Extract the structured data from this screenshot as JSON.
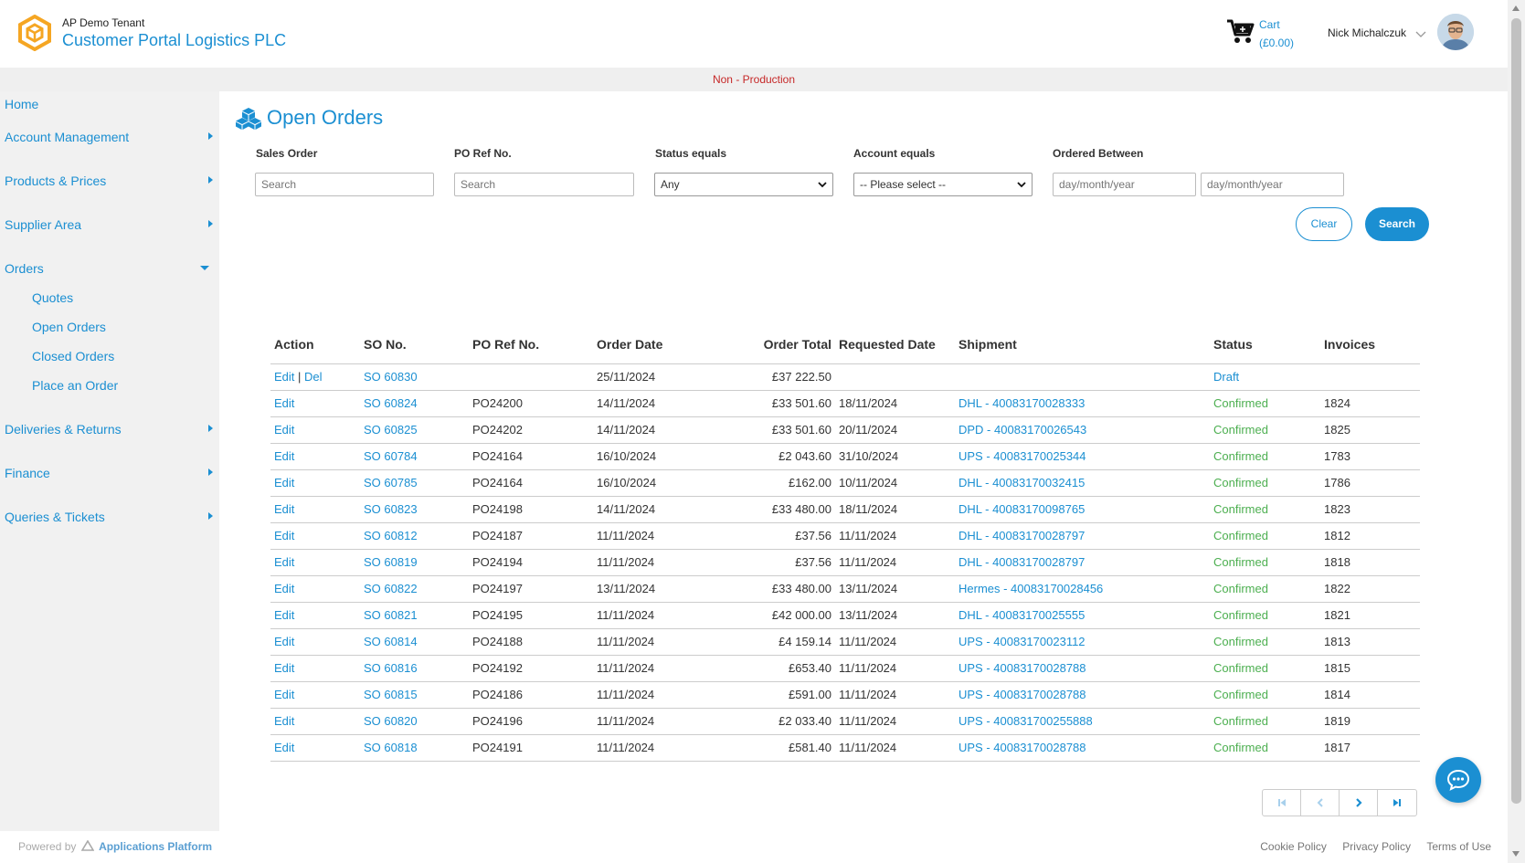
{
  "header": {
    "tenant": "AP Demo Tenant",
    "portal_title": "Customer Portal Logistics PLC",
    "cart_label": "Cart",
    "cart_total": "(£0.00)",
    "user_name": "Nick Michalczuk"
  },
  "environment": "Non - Production",
  "sidebar": {
    "items": [
      {
        "label": "Home"
      },
      {
        "label": "Account Management"
      },
      {
        "label": "Products & Prices"
      },
      {
        "label": "Supplier Area"
      },
      {
        "label": "Orders"
      },
      {
        "label": "Deliveries & Returns"
      },
      {
        "label": "Finance"
      },
      {
        "label": "Queries & Tickets"
      }
    ],
    "orders_sub": [
      {
        "label": "Quotes"
      },
      {
        "label": "Open Orders"
      },
      {
        "label": "Closed Orders"
      },
      {
        "label": "Place an Order"
      }
    ]
  },
  "page": {
    "title": "Open Orders"
  },
  "filters": {
    "sales_order_label": "Sales Order",
    "sales_order_placeholder": "Search",
    "po_ref_label": "PO Ref No.",
    "po_ref_placeholder": "Search",
    "status_label": "Status equals",
    "status_value": "Any",
    "account_label": "Account equals",
    "account_value": "-- Please select --",
    "ordered_between_label": "Ordered Between",
    "date_from_placeholder": "day/month/year",
    "date_to_placeholder": "day/month/year",
    "clear_label": "Clear",
    "search_label": "Search"
  },
  "table": {
    "headers": [
      "Action",
      "SO No.",
      "PO Ref No.",
      "Order Date",
      "Order Total",
      "Requested Date",
      "Shipment",
      "Status",
      "Invoices"
    ],
    "edit_label": "Edit",
    "del_label": "Del",
    "rows": [
      {
        "so": "SO 60830",
        "po": "",
        "order_date": "25/11/2024",
        "total": "£37 222.50",
        "requested": "",
        "shipment": "",
        "status": "Draft",
        "invoice": ""
      },
      {
        "so": "SO 60824",
        "po": "PO24200",
        "order_date": "14/11/2024",
        "total": "£33 501.60",
        "requested": "18/11/2024",
        "shipment": "DHL - 40083170028333",
        "status": "Confirmed",
        "invoice": "1824"
      },
      {
        "so": "SO 60825",
        "po": "PO24202",
        "order_date": "14/11/2024",
        "total": "£33 501.60",
        "requested": "20/11/2024",
        "shipment": "DPD - 40083170026543",
        "status": "Confirmed",
        "invoice": "1825"
      },
      {
        "so": "SO 60784",
        "po": "PO24164",
        "order_date": "16/10/2024",
        "total": "£2 043.60",
        "requested": "31/10/2024",
        "shipment": "UPS - 40083170025344",
        "status": "Confirmed",
        "invoice": "1783"
      },
      {
        "so": "SO 60785",
        "po": "PO24164",
        "order_date": "16/10/2024",
        "total": "£162.00",
        "requested": "10/11/2024",
        "shipment": "DHL - 40083170032415",
        "status": "Confirmed",
        "invoice": "1786"
      },
      {
        "so": "SO 60823",
        "po": "PO24198",
        "order_date": "14/11/2024",
        "total": "£33 480.00",
        "requested": "18/11/2024",
        "shipment": "DHL - 40083170098765",
        "status": "Confirmed",
        "invoice": "1823"
      },
      {
        "so": "SO 60812",
        "po": "PO24187",
        "order_date": "11/11/2024",
        "total": "£37.56",
        "requested": "11/11/2024",
        "shipment": "DHL - 40083170028797",
        "status": "Confirmed",
        "invoice": "1812"
      },
      {
        "so": "SO 60819",
        "po": "PO24194",
        "order_date": "11/11/2024",
        "total": "£37.56",
        "requested": "11/11/2024",
        "shipment": "DHL - 40083170028797",
        "status": "Confirmed",
        "invoice": "1818"
      },
      {
        "so": "SO 60822",
        "po": "PO24197",
        "order_date": "13/11/2024",
        "total": "£33 480.00",
        "requested": "13/11/2024",
        "shipment": "Hermes - 40083170028456",
        "status": "Confirmed",
        "invoice": "1822"
      },
      {
        "so": "SO 60821",
        "po": "PO24195",
        "order_date": "11/11/2024",
        "total": "£42 000.00",
        "requested": "13/11/2024",
        "shipment": "DHL - 40083170025555",
        "status": "Confirmed",
        "invoice": "1821"
      },
      {
        "so": "SO 60814",
        "po": "PO24188",
        "order_date": "11/11/2024",
        "total": "£4 159.14",
        "requested": "11/11/2024",
        "shipment": "UPS - 40083170023112",
        "status": "Confirmed",
        "invoice": "1813"
      },
      {
        "so": "SO 60816",
        "po": "PO24192",
        "order_date": "11/11/2024",
        "total": "£653.40",
        "requested": "11/11/2024",
        "shipment": "UPS - 40083170028788",
        "status": "Confirmed",
        "invoice": "1815"
      },
      {
        "so": "SO 60815",
        "po": "PO24186",
        "order_date": "11/11/2024",
        "total": "£591.00",
        "requested": "11/11/2024",
        "shipment": "UPS - 40083170028788",
        "status": "Confirmed",
        "invoice": "1814"
      },
      {
        "so": "SO 60820",
        "po": "PO24196",
        "order_date": "11/11/2024",
        "total": "£2 033.40",
        "requested": "11/11/2024",
        "shipment": "UPS - 400831700255888",
        "status": "Confirmed",
        "invoice": "1819"
      },
      {
        "so": "SO 60818",
        "po": "PO24191",
        "order_date": "11/11/2024",
        "total": "£581.40",
        "requested": "11/11/2024",
        "shipment": "UPS - 40083170028788",
        "status": "Confirmed",
        "invoice": "1817"
      }
    ]
  },
  "footer": {
    "powered_by": "Powered by",
    "platform": "Applications Platform",
    "links": [
      "Cookie Policy",
      "Privacy Policy",
      "Terms of Use"
    ]
  },
  "icons": [
    "app-logo-icon",
    "cart-icon",
    "chevron-down-icon",
    "avatar",
    "boxes-icon",
    "caret-right-icon",
    "caret-down-icon",
    "first-page-icon",
    "prev-page-icon",
    "next-page-icon",
    "last-page-icon",
    "chat-icon"
  ],
  "colors": {
    "accent": "#1b8fd2",
    "logo_orange": "#f5a623",
    "confirmed": "#4caf50",
    "env_warning": "#c62828"
  }
}
